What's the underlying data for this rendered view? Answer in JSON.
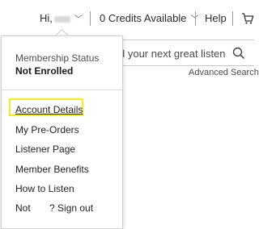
{
  "header": {
    "greeting": "Hi,",
    "credits": "0 Credits Available",
    "help": "Help"
  },
  "search": {
    "placeholder": "d your next great listen",
    "advanced": "Advanced Search"
  },
  "account_menu": {
    "membership_label": "Membership Status",
    "membership_value": "Not Enrolled",
    "items": [
      "Account Details",
      "My Pre-Orders",
      "Listener Page",
      "Member Benefits",
      "How to Listen",
      "Not       ? Sign out"
    ]
  },
  "colors": {
    "highlight": "#f3ee1a"
  }
}
